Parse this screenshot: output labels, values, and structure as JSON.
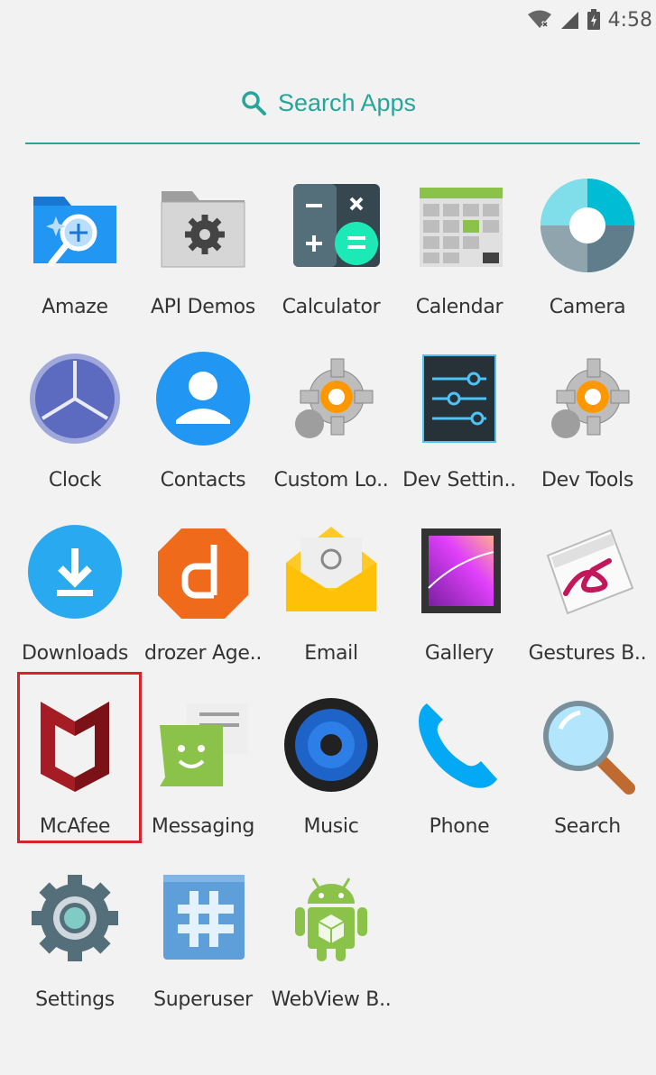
{
  "status_bar": {
    "time": "4:58",
    "icons": [
      "wifi-off-icon",
      "signal-icon",
      "battery-icon"
    ]
  },
  "search": {
    "label": "Search Apps",
    "icon": "search-icon",
    "accent": "#26a69a"
  },
  "highlight_color": "#d8232a",
  "apps": [
    {
      "label": "Amaze",
      "icon": "amaze-icon"
    },
    {
      "label": "API Demos",
      "icon": "folder-gear-icon"
    },
    {
      "label": "Calculator",
      "icon": "calculator-icon"
    },
    {
      "label": "Calendar",
      "icon": "calendar-icon"
    },
    {
      "label": "Camera",
      "icon": "camera-icon"
    },
    {
      "label": "Clock",
      "icon": "clock-icon"
    },
    {
      "label": "Contacts",
      "icon": "contacts-icon"
    },
    {
      "label": "Custom Lo..",
      "icon": "gear-icon"
    },
    {
      "label": "Dev Settin..",
      "icon": "sliders-icon"
    },
    {
      "label": "Dev Tools",
      "icon": "gear-icon"
    },
    {
      "label": "Downloads",
      "icon": "download-icon"
    },
    {
      "label": "drozer Age..",
      "icon": "drozer-icon"
    },
    {
      "label": "Email",
      "icon": "email-icon"
    },
    {
      "label": "Gallery",
      "icon": "gallery-icon"
    },
    {
      "label": "Gestures B..",
      "icon": "gestures-icon"
    },
    {
      "label": "McAfee",
      "icon": "mcafee-icon"
    },
    {
      "label": "Messaging",
      "icon": "messaging-icon"
    },
    {
      "label": "Music",
      "icon": "speaker-icon"
    },
    {
      "label": "Phone",
      "icon": "phone-icon"
    },
    {
      "label": "Search",
      "icon": "magnifier-icon"
    },
    {
      "label": "Settings",
      "icon": "settings-icon"
    },
    {
      "label": "Superuser",
      "icon": "hash-icon"
    },
    {
      "label": "WebView B..",
      "icon": "android-icon"
    }
  ]
}
